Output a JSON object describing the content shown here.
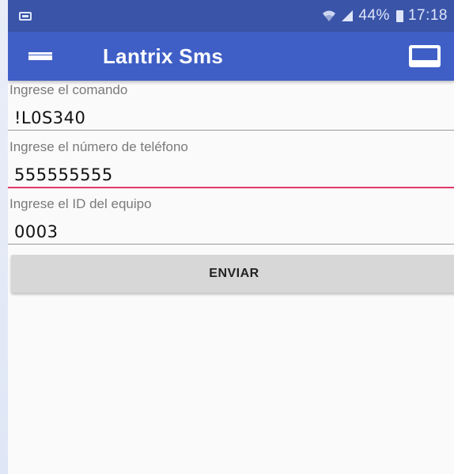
{
  "statusbar": {
    "battery_percent": "44%",
    "time": "17:18",
    "icons": [
      "notification-icon",
      "wifi-icon",
      "signal-icon",
      "battery-icon"
    ]
  },
  "appbar": {
    "title": "Lantrix Sms",
    "menu_icon": "hamburger-menu-icon",
    "action_icon": "cast-icon"
  },
  "form": {
    "command_label": "Ingrese el comando",
    "command_value": "!L0S340",
    "phone_label": "Ingrese el número de teléfono",
    "phone_value": "555555555",
    "device_label": "Ingrese el ID del equipo",
    "device_value": "0003",
    "send_label": "ENVIAR"
  },
  "colors": {
    "statusbar": "#3a54a8",
    "appbar": "#3f5fc6",
    "focus_underline": "#e0396a",
    "button": "#d7d7d7"
  }
}
